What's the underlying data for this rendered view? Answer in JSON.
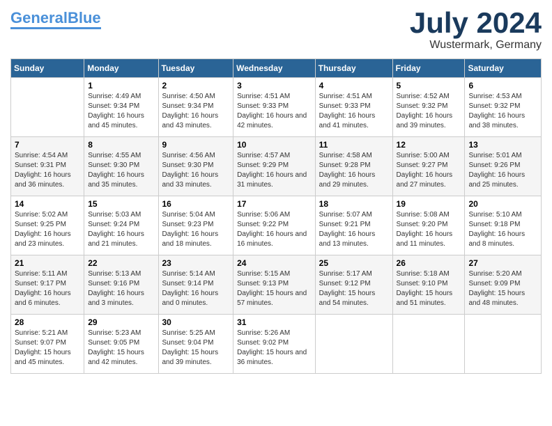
{
  "logo": {
    "text1": "General",
    "text2": "Blue"
  },
  "title": "July 2024",
  "location": "Wustermark, Germany",
  "days_of_week": [
    "Sunday",
    "Monday",
    "Tuesday",
    "Wednesday",
    "Thursday",
    "Friday",
    "Saturday"
  ],
  "weeks": [
    [
      {
        "day": "",
        "sunrise": "",
        "sunset": "",
        "daylight": ""
      },
      {
        "day": "1",
        "sunrise": "Sunrise: 4:49 AM",
        "sunset": "Sunset: 9:34 PM",
        "daylight": "Daylight: 16 hours and 45 minutes."
      },
      {
        "day": "2",
        "sunrise": "Sunrise: 4:50 AM",
        "sunset": "Sunset: 9:34 PM",
        "daylight": "Daylight: 16 hours and 43 minutes."
      },
      {
        "day": "3",
        "sunrise": "Sunrise: 4:51 AM",
        "sunset": "Sunset: 9:33 PM",
        "daylight": "Daylight: 16 hours and 42 minutes."
      },
      {
        "day": "4",
        "sunrise": "Sunrise: 4:51 AM",
        "sunset": "Sunset: 9:33 PM",
        "daylight": "Daylight: 16 hours and 41 minutes."
      },
      {
        "day": "5",
        "sunrise": "Sunrise: 4:52 AM",
        "sunset": "Sunset: 9:32 PM",
        "daylight": "Daylight: 16 hours and 39 minutes."
      },
      {
        "day": "6",
        "sunrise": "Sunrise: 4:53 AM",
        "sunset": "Sunset: 9:32 PM",
        "daylight": "Daylight: 16 hours and 38 minutes."
      }
    ],
    [
      {
        "day": "7",
        "sunrise": "Sunrise: 4:54 AM",
        "sunset": "Sunset: 9:31 PM",
        "daylight": "Daylight: 16 hours and 36 minutes."
      },
      {
        "day": "8",
        "sunrise": "Sunrise: 4:55 AM",
        "sunset": "Sunset: 9:30 PM",
        "daylight": "Daylight: 16 hours and 35 minutes."
      },
      {
        "day": "9",
        "sunrise": "Sunrise: 4:56 AM",
        "sunset": "Sunset: 9:30 PM",
        "daylight": "Daylight: 16 hours and 33 minutes."
      },
      {
        "day": "10",
        "sunrise": "Sunrise: 4:57 AM",
        "sunset": "Sunset: 9:29 PM",
        "daylight": "Daylight: 16 hours and 31 minutes."
      },
      {
        "day": "11",
        "sunrise": "Sunrise: 4:58 AM",
        "sunset": "Sunset: 9:28 PM",
        "daylight": "Daylight: 16 hours and 29 minutes."
      },
      {
        "day": "12",
        "sunrise": "Sunrise: 5:00 AM",
        "sunset": "Sunset: 9:27 PM",
        "daylight": "Daylight: 16 hours and 27 minutes."
      },
      {
        "day": "13",
        "sunrise": "Sunrise: 5:01 AM",
        "sunset": "Sunset: 9:26 PM",
        "daylight": "Daylight: 16 hours and 25 minutes."
      }
    ],
    [
      {
        "day": "14",
        "sunrise": "Sunrise: 5:02 AM",
        "sunset": "Sunset: 9:25 PM",
        "daylight": "Daylight: 16 hours and 23 minutes."
      },
      {
        "day": "15",
        "sunrise": "Sunrise: 5:03 AM",
        "sunset": "Sunset: 9:24 PM",
        "daylight": "Daylight: 16 hours and 21 minutes."
      },
      {
        "day": "16",
        "sunrise": "Sunrise: 5:04 AM",
        "sunset": "Sunset: 9:23 PM",
        "daylight": "Daylight: 16 hours and 18 minutes."
      },
      {
        "day": "17",
        "sunrise": "Sunrise: 5:06 AM",
        "sunset": "Sunset: 9:22 PM",
        "daylight": "Daylight: 16 hours and 16 minutes."
      },
      {
        "day": "18",
        "sunrise": "Sunrise: 5:07 AM",
        "sunset": "Sunset: 9:21 PM",
        "daylight": "Daylight: 16 hours and 13 minutes."
      },
      {
        "day": "19",
        "sunrise": "Sunrise: 5:08 AM",
        "sunset": "Sunset: 9:20 PM",
        "daylight": "Daylight: 16 hours and 11 minutes."
      },
      {
        "day": "20",
        "sunrise": "Sunrise: 5:10 AM",
        "sunset": "Sunset: 9:18 PM",
        "daylight": "Daylight: 16 hours and 8 minutes."
      }
    ],
    [
      {
        "day": "21",
        "sunrise": "Sunrise: 5:11 AM",
        "sunset": "Sunset: 9:17 PM",
        "daylight": "Daylight: 16 hours and 6 minutes."
      },
      {
        "day": "22",
        "sunrise": "Sunrise: 5:13 AM",
        "sunset": "Sunset: 9:16 PM",
        "daylight": "Daylight: 16 hours and 3 minutes."
      },
      {
        "day": "23",
        "sunrise": "Sunrise: 5:14 AM",
        "sunset": "Sunset: 9:14 PM",
        "daylight": "Daylight: 16 hours and 0 minutes."
      },
      {
        "day": "24",
        "sunrise": "Sunrise: 5:15 AM",
        "sunset": "Sunset: 9:13 PM",
        "daylight": "Daylight: 15 hours and 57 minutes."
      },
      {
        "day": "25",
        "sunrise": "Sunrise: 5:17 AM",
        "sunset": "Sunset: 9:12 PM",
        "daylight": "Daylight: 15 hours and 54 minutes."
      },
      {
        "day": "26",
        "sunrise": "Sunrise: 5:18 AM",
        "sunset": "Sunset: 9:10 PM",
        "daylight": "Daylight: 15 hours and 51 minutes."
      },
      {
        "day": "27",
        "sunrise": "Sunrise: 5:20 AM",
        "sunset": "Sunset: 9:09 PM",
        "daylight": "Daylight: 15 hours and 48 minutes."
      }
    ],
    [
      {
        "day": "28",
        "sunrise": "Sunrise: 5:21 AM",
        "sunset": "Sunset: 9:07 PM",
        "daylight": "Daylight: 15 hours and 45 minutes."
      },
      {
        "day": "29",
        "sunrise": "Sunrise: 5:23 AM",
        "sunset": "Sunset: 9:05 PM",
        "daylight": "Daylight: 15 hours and 42 minutes."
      },
      {
        "day": "30",
        "sunrise": "Sunrise: 5:25 AM",
        "sunset": "Sunset: 9:04 PM",
        "daylight": "Daylight: 15 hours and 39 minutes."
      },
      {
        "day": "31",
        "sunrise": "Sunrise: 5:26 AM",
        "sunset": "Sunset: 9:02 PM",
        "daylight": "Daylight: 15 hours and 36 minutes."
      },
      {
        "day": "",
        "sunrise": "",
        "sunset": "",
        "daylight": ""
      },
      {
        "day": "",
        "sunrise": "",
        "sunset": "",
        "daylight": ""
      },
      {
        "day": "",
        "sunrise": "",
        "sunset": "",
        "daylight": ""
      }
    ]
  ]
}
